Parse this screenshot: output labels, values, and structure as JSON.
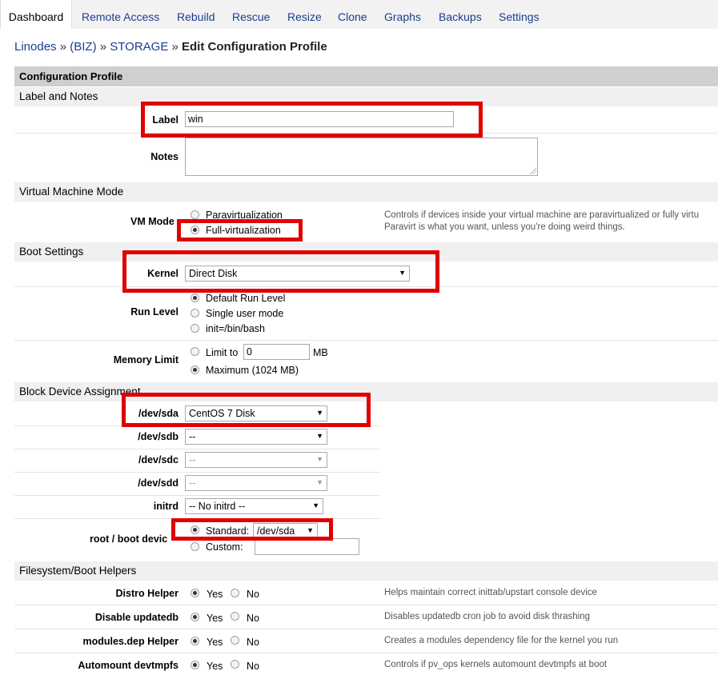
{
  "tabs": [
    "Dashboard",
    "Remote Access",
    "Rebuild",
    "Rescue",
    "Resize",
    "Clone",
    "Graphs",
    "Backups",
    "Settings"
  ],
  "breadcrumb": {
    "linodes": "Linodes",
    "sep": "»",
    "group": "(BIZ)",
    "linode": "STORAGE",
    "current": "Edit Configuration Profile"
  },
  "panel_title": "Configuration Profile",
  "sections": {
    "label_notes": "Label and Notes",
    "vm_mode": "Virtual Machine Mode",
    "boot": "Boot Settings",
    "block": "Block Device Assignment",
    "helpers": "Filesystem/Boot Helpers"
  },
  "label": {
    "label": "Label",
    "value": "win"
  },
  "notes": {
    "label": "Notes",
    "value": ""
  },
  "vm_mode": {
    "label": "VM Mode",
    "options": [
      "Paravirtualization",
      "Full-virtualization"
    ],
    "selected": "Full-virtualization",
    "help_line1": "Controls if devices inside your virtual machine are paravirtualized or fully virtu",
    "help_line2": "Paravirt is what you want, unless you're doing weird things."
  },
  "kernel": {
    "label": "Kernel",
    "value": "Direct Disk"
  },
  "run_level": {
    "label": "Run Level",
    "options": [
      "Default Run Level",
      "Single user mode",
      "init=/bin/bash"
    ],
    "selected": "Default Run Level"
  },
  "memory_limit": {
    "label": "Memory Limit",
    "limit_label": "Limit to",
    "limit_value": "0",
    "unit": "MB",
    "max_label": "Maximum (1024 MB)",
    "selected": "Maximum"
  },
  "devices": [
    {
      "label": "/dev/sda",
      "value": "CentOS 7 Disk"
    },
    {
      "label": "/dev/sdb",
      "value": "--"
    },
    {
      "label": "/dev/sdc",
      "value": "--"
    },
    {
      "label": "/dev/sdd",
      "value": "--"
    },
    {
      "label": "initrd",
      "value": "-- No initrd --"
    }
  ],
  "root_device": {
    "label": "root / boot devic",
    "standard_label": "Standard:",
    "standard_value": "/dev/sda",
    "custom_label": "Custom:",
    "custom_value": ""
  },
  "helpers": [
    {
      "label": "Distro Helper",
      "yes": "Yes",
      "no": "No",
      "selected": "Yes",
      "help": "Helps maintain correct inittab/upstart console device"
    },
    {
      "label": "Disable updatedb",
      "yes": "Yes",
      "no": "No",
      "selected": "Yes",
      "help": "Disables updatedb cron job to avoid disk thrashing"
    },
    {
      "label": "modules.dep Helper",
      "yes": "Yes",
      "no": "No",
      "selected": "Yes",
      "help": "Creates a modules dependency file for the kernel you run"
    },
    {
      "label": "Automount devtmpfs",
      "yes": "Yes",
      "no": "No",
      "selected": "Yes",
      "help": "Controls if pv_ops kernels automount devtmpfs at boot"
    }
  ],
  "colors": {
    "highlight": "#e00000",
    "link": "#1a3d8f",
    "section_bg": "#f0f0f0",
    "panel_head_bg": "#cfcfcf"
  }
}
